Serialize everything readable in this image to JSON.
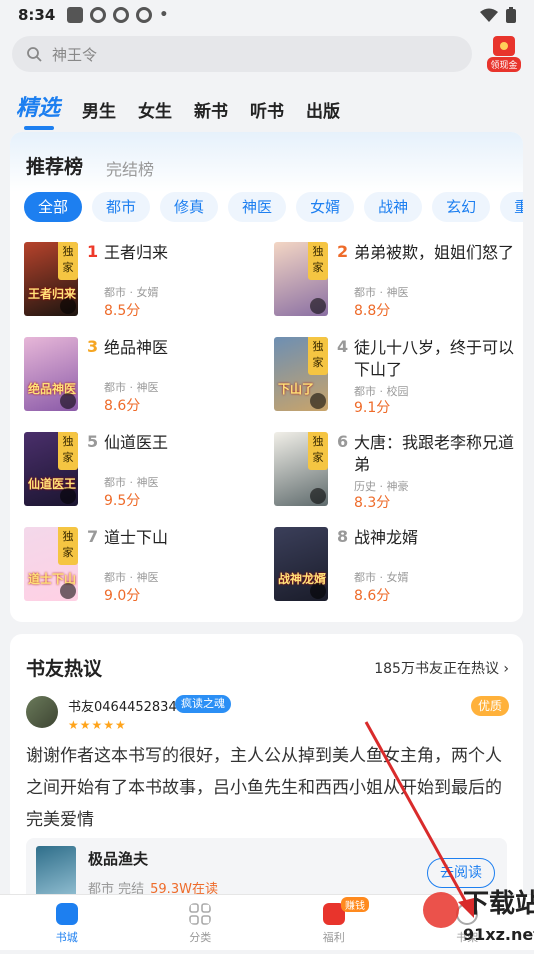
{
  "status": {
    "time": "8:34"
  },
  "search": {
    "placeholder": "神王令"
  },
  "redpack": {
    "label": "领现金"
  },
  "tabs": [
    "精选",
    "男生",
    "女生",
    "新书",
    "听书",
    "出版"
  ],
  "ranking": {
    "title": "推荐榜",
    "sub": "完结榜",
    "chips": [
      "全部",
      "都市",
      "修真",
      "神医",
      "女婿",
      "战神",
      "玄幻",
      "重"
    ],
    "books": [
      {
        "rank": "1",
        "title": "王者归来",
        "meta": "都市 · 女婿",
        "score": "8.5分",
        "badge": "独家",
        "cover_text": "王者归来",
        "rank_color": "#ee3a2a"
      },
      {
        "rank": "2",
        "title": "弟弟被欺，姐姐们怒了",
        "meta": "都市 · 神医",
        "score": "8.8分",
        "badge": "独家",
        "cover_text": "",
        "rank_color": "#ee6b2a"
      },
      {
        "rank": "3",
        "title": "绝品神医",
        "meta": "都市 · 神医",
        "score": "8.6分",
        "badge": "",
        "cover_text": "绝品神医",
        "rank_color": "#f5a623"
      },
      {
        "rank": "4",
        "title": "徒儿十八岁，终于可以下山了",
        "meta": "都市 · 校园",
        "score": "9.1分",
        "badge": "独家",
        "cover_text": "下山了",
        "rank_color": "#999"
      },
      {
        "rank": "5",
        "title": "仙道医王",
        "meta": "都市 · 神医",
        "score": "9.5分",
        "badge": "独家",
        "cover_text": "仙道医王",
        "rank_color": "#999"
      },
      {
        "rank": "6",
        "title": "大唐：我跟老李称兄道弟",
        "meta": "历史 · 神豪",
        "score": "8.3分",
        "badge": "独家",
        "cover_text": "",
        "rank_color": "#999"
      },
      {
        "rank": "7",
        "title": "道士下山",
        "meta": "都市 · 神医",
        "score": "9.0分",
        "badge": "独家",
        "cover_text": "道士下山",
        "rank_color": "#999"
      },
      {
        "rank": "8",
        "title": "战神龙婿",
        "meta": "都市 · 女婿",
        "score": "8.6分",
        "badge": "",
        "cover_text": "战神龙婿",
        "rank_color": "#999"
      }
    ]
  },
  "discussion": {
    "title": "书友热议",
    "more": "185万书友正在热议 ›",
    "user": "书友0464452834",
    "user_badge": "疯读之魂",
    "stars": "★★★★★",
    "quality": "优质",
    "comment": "谢谢作者这本书写的很好，主人公从掉到美人鱼女主角，两个人之间开始有了本书故事，吕小鱼先生和西西小姐从开始到最后的完美爱情",
    "book": {
      "title": "极品渔夫",
      "meta": "都市  完结",
      "heat": "59.3W在读",
      "button": "去阅读"
    }
  },
  "bottom_nav": [
    {
      "label": "书城",
      "active": true
    },
    {
      "label": "分类",
      "active": false
    },
    {
      "label": "福利",
      "active": false,
      "tag": "赚钱"
    },
    {
      "label": "书架",
      "active": false
    }
  ],
  "watermark": {
    "text": "下载站",
    "url": "91xz.net"
  },
  "colors": {
    "accent": "#1d7ff0",
    "score": "#ee6b2a",
    "redpack": "#e8342c"
  }
}
